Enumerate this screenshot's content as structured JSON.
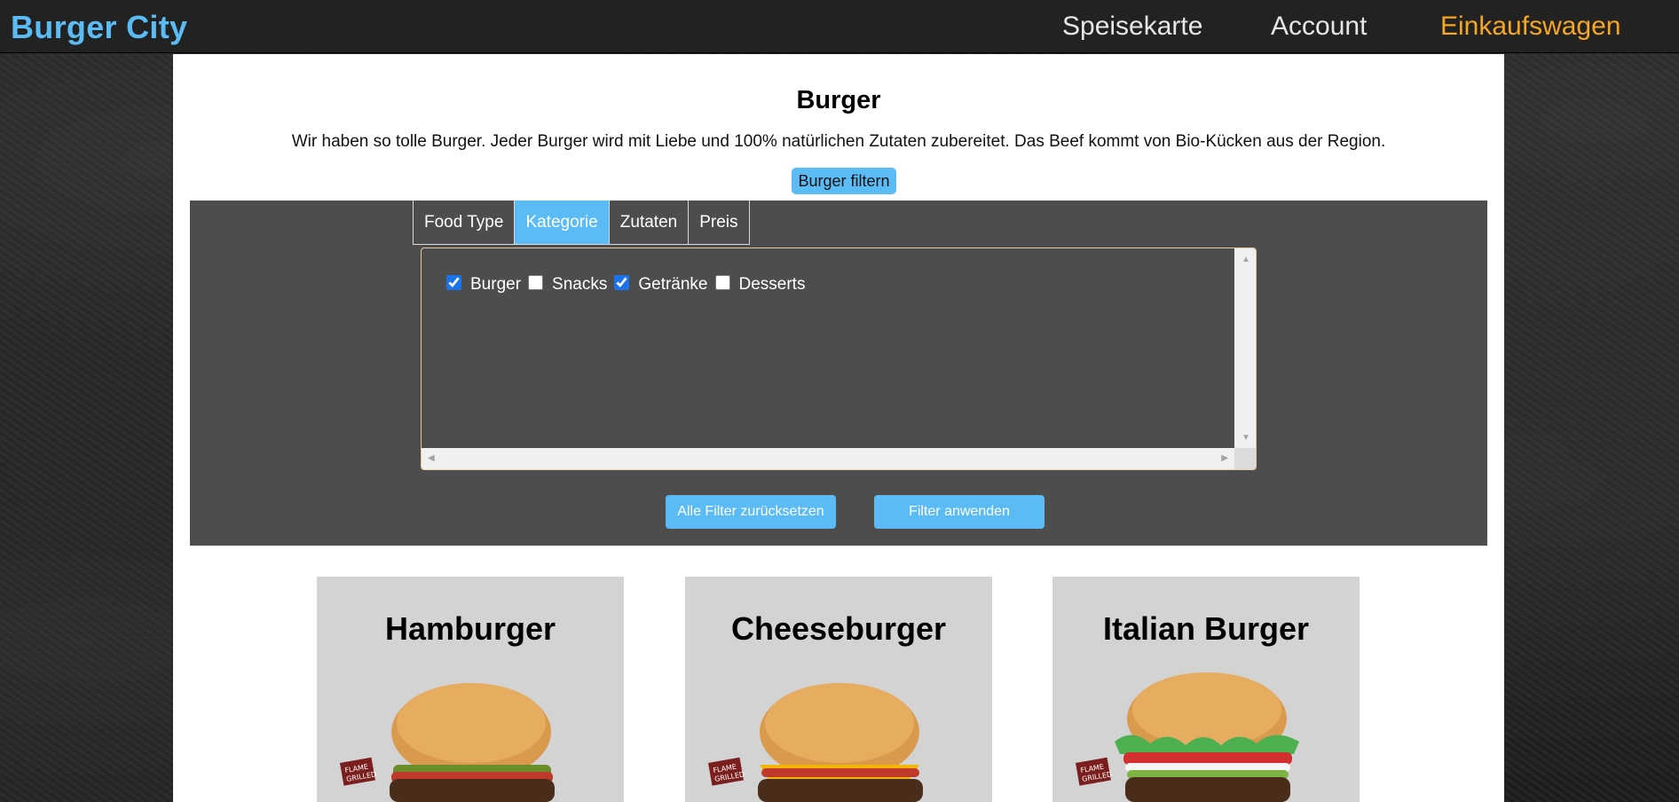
{
  "nav": {
    "brand": "Burger City",
    "links": [
      "Speisekarte",
      "Account",
      "Einkaufswagen"
    ]
  },
  "page": {
    "title": "Burger",
    "intro": "Wir haben so tolle Burger. Jeder Burger wird mit Liebe und 100% natürlichen Zutaten zubereitet. Das Beef kommt von Bio-Kücken aus der Region.",
    "filter_toggle": "Burger filtern"
  },
  "filter": {
    "tabs": [
      "Food Type",
      "Kategorie",
      "Zutaten",
      "Preis"
    ],
    "active_tab": "Kategorie",
    "categories": [
      {
        "label": "Burger",
        "checked": true
      },
      {
        "label": "Snacks",
        "checked": false
      },
      {
        "label": "Getränke",
        "checked": true
      },
      {
        "label": "Desserts",
        "checked": false
      }
    ],
    "reset_label": "Alle Filter zurücksetzen",
    "apply_label": "Filter anwenden"
  },
  "products": [
    {
      "name": "Hamburger",
      "image": "hamburger-image"
    },
    {
      "name": "Cheeseburger",
      "image": "cheeseburger-image"
    },
    {
      "name": "Italian Burger",
      "image": "italian-burger-image"
    }
  ],
  "colors": {
    "accent": "#5bbcf5",
    "active_nav": "#f5a623",
    "panel": "#4d4d4d",
    "card": "#d3d3d3"
  }
}
